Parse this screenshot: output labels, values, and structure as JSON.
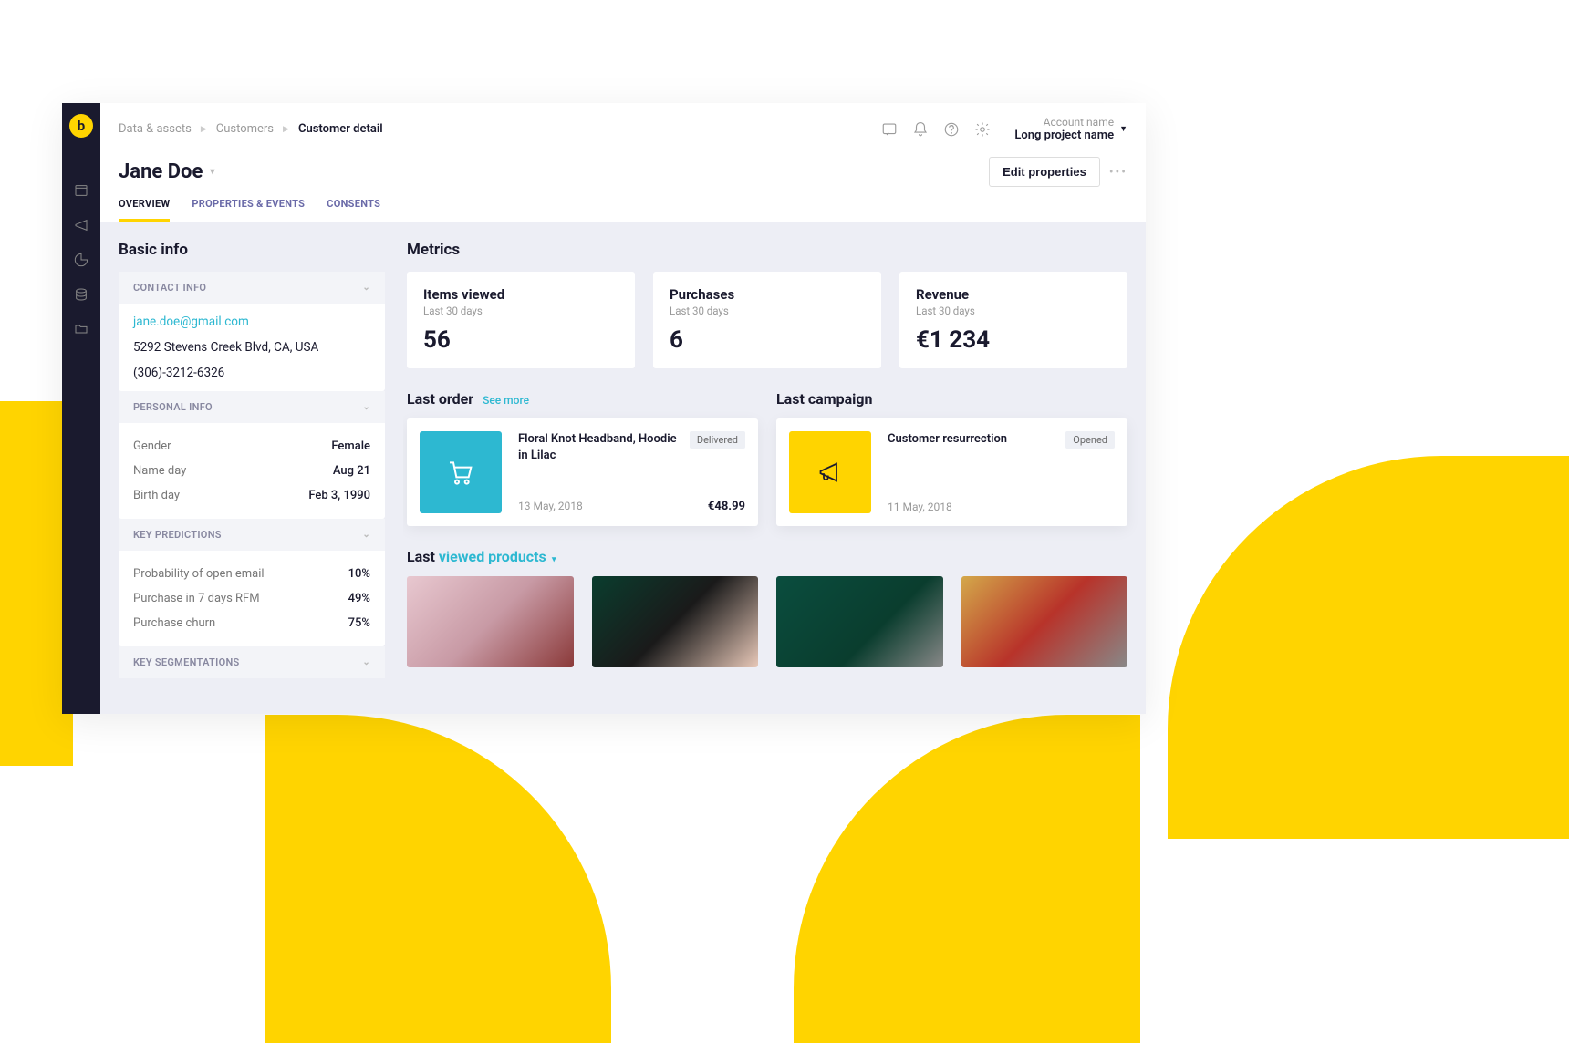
{
  "breadcrumb": {
    "item1": "Data & assets",
    "item2": "Customers",
    "current": "Customer detail"
  },
  "account": {
    "line1": "Account name",
    "line2": "Long project name"
  },
  "page_title": "Jane Doe",
  "edit_button": "Edit properties",
  "tabs": {
    "overview": "OVERVIEW",
    "properties": "PROPERTIES & EVENTS",
    "consents": "CONSENTS"
  },
  "basic_info": {
    "heading": "Basic info",
    "contact": {
      "header": "CONTACT INFO",
      "email": "jane.doe@gmail.com",
      "address": "5292 Stevens Creek Blvd, CA, USA",
      "phone": "(306)-3212-6326"
    },
    "personal": {
      "header": "PERSONAL INFO",
      "gender_k": "Gender",
      "gender_v": "Female",
      "nameday_k": "Name day",
      "nameday_v": "Aug 21",
      "birthday_k": "Birth day",
      "birthday_v": "Feb 3, 1990"
    },
    "predictions": {
      "header": "KEY PREDICTIONS",
      "p1_k": "Probability of open email",
      "p1_v": "10%",
      "p2_k": "Purchase in 7 days RFM",
      "p2_v": "49%",
      "p3_k": "Purchase churn",
      "p3_v": "75%"
    },
    "segmentations": {
      "header": "KEY SEGMENTATIONS"
    }
  },
  "metrics": {
    "heading": "Metrics",
    "sub": "Last 30 days",
    "m1_t": "Items viewed",
    "m1_v": "56",
    "m2_t": "Purchases",
    "m2_v": "6",
    "m3_t": "Revenue",
    "m3_v": "€1 234"
  },
  "last_order": {
    "heading": "Last order",
    "see_more": "See more",
    "title": "Floral Knot Headband, Hoodie in Lilac",
    "badge": "Delivered",
    "date": "13 May, 2018",
    "price": "€48.99"
  },
  "last_campaign": {
    "heading": "Last campaign",
    "title": "Customer resurrection",
    "badge": "Opened",
    "date": "11 May, 2018"
  },
  "last_viewed": {
    "prefix": "Last ",
    "highlight": "viewed products"
  }
}
